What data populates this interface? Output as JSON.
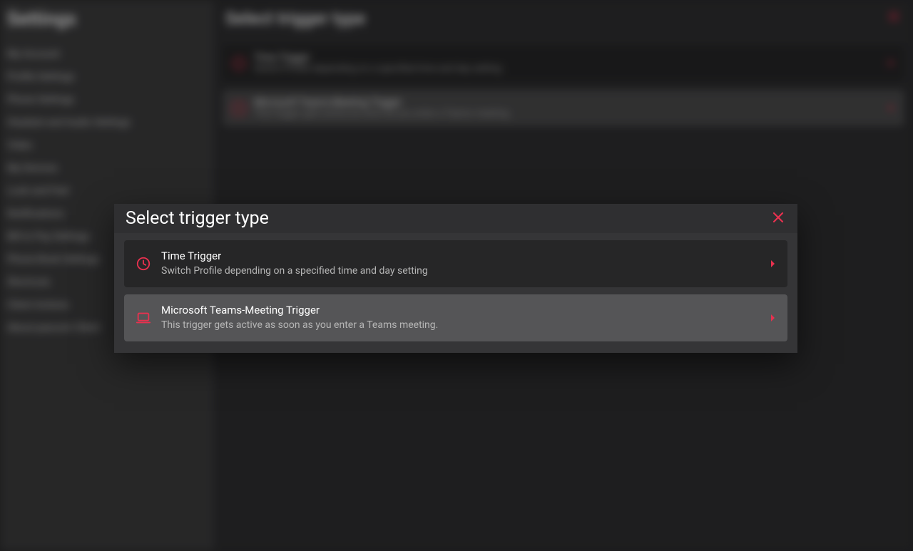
{
  "colors": {
    "accent": "#e8314f"
  },
  "sidebar": {
    "title": "Settings",
    "items": [
      "My Account",
      "Profile Settings",
      "Phone Settings",
      "Headset and Audio Settings",
      "Video",
      "My Devices",
      "Look and Feel",
      "Notifications",
      "Bill to Pay Settings",
      "Phone Book Settings",
      "Shortcuts",
      "Client Actions",
      "About pascom Client"
    ]
  },
  "bg_panel": {
    "title": "Select trigger type",
    "options": [
      {
        "title": "Time Trigger",
        "desc": "Switch Profile depending on a specified time and day setting"
      },
      {
        "title": "Microsoft Teams-Meeting Trigger",
        "desc": "This trigger gets active as soon as you enter a Teams meeting."
      }
    ]
  },
  "modal": {
    "title": "Select trigger type",
    "options": [
      {
        "icon": "clock-icon",
        "title": "Time Trigger",
        "desc": "Switch Profile depending on a specified time and day setting",
        "hovered": false
      },
      {
        "icon": "laptop-icon",
        "title": "Microsoft Teams-Meeting Trigger",
        "desc": "This trigger gets active as soon as you enter a Teams meeting.",
        "hovered": true
      }
    ]
  }
}
